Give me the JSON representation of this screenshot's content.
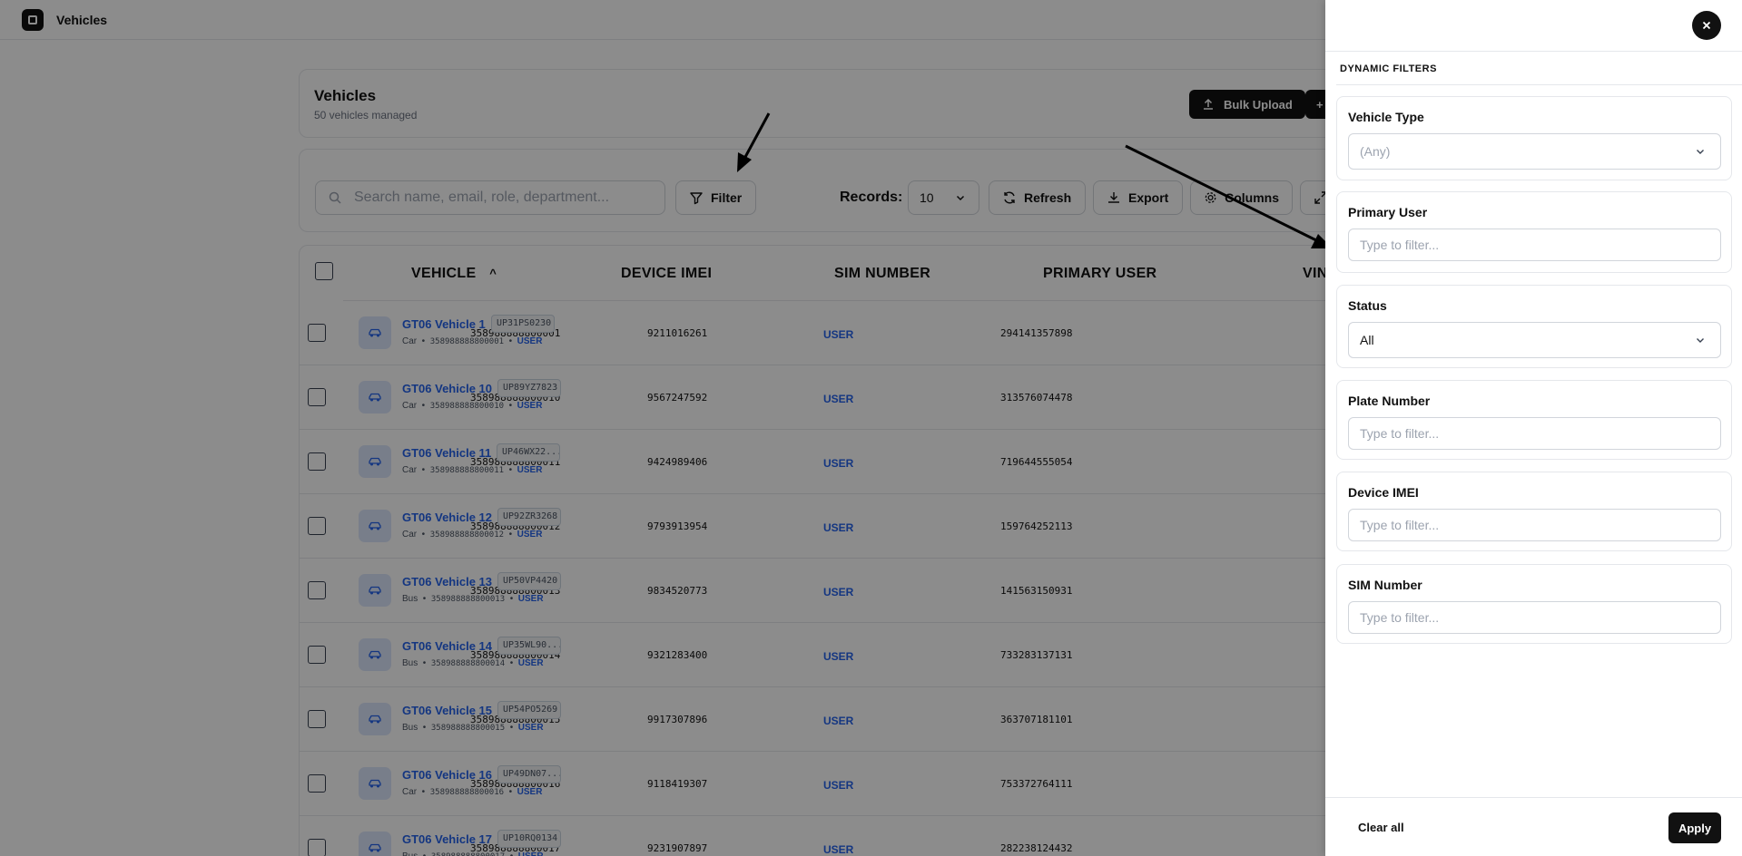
{
  "app": {
    "title": "Vehicles"
  },
  "header": {
    "title": "Vehicles",
    "subtitle": "50 vehicles managed",
    "bulk_upload_label": "Bulk Upload",
    "add_label": "+"
  },
  "toolbar": {
    "search_placeholder": "Search name, email, role, department...",
    "filter_label": "Filter",
    "records_label": "Records:",
    "records_value": "10",
    "refresh_label": "Refresh",
    "export_label": "Export",
    "columns_label": "Columns"
  },
  "table": {
    "columns": [
      "VEHICLE",
      "DEVICE IMEI",
      "SIM NUMBER",
      "PRIMARY USER",
      "VIN"
    ],
    "sort_indicator": "^",
    "rows": [
      {
        "name": "GT06 Vehicle 1",
        "plate": "UP31PS0230",
        "type": "Car",
        "imei_short": "358988888800001",
        "imei": "358988888800001",
        "user_tag": "USER",
        "sim": "9211016261",
        "primary_user": "USER",
        "vin": "294141357898"
      },
      {
        "name": "GT06 Vehicle 10",
        "plate": "UP89YZ7823",
        "type": "Car",
        "imei_short": "358988888800010",
        "imei": "358988888800010",
        "user_tag": "USER",
        "sim": "9567247592",
        "primary_user": "USER",
        "vin": "313576074478"
      },
      {
        "name": "GT06 Vehicle 11",
        "plate": "UP46WX22...",
        "type": "Car",
        "imei_short": "358988888800011",
        "imei": "358988888800011",
        "user_tag": "USER",
        "sim": "9424989406",
        "primary_user": "USER",
        "vin": "719644555054"
      },
      {
        "name": "GT06 Vehicle 12",
        "plate": "UP92ZR3268",
        "type": "Car",
        "imei_short": "358988888800012",
        "imei": "358988888800012",
        "user_tag": "USER",
        "sim": "9793913954",
        "primary_user": "USER",
        "vin": "159764252113"
      },
      {
        "name": "GT06 Vehicle 13",
        "plate": "UP50VP4420",
        "type": "Bus",
        "imei_short": "358988888800013",
        "imei": "358988888800013",
        "user_tag": "USER",
        "sim": "9834520773",
        "primary_user": "USER",
        "vin": "141563150931"
      },
      {
        "name": "GT06 Vehicle 14",
        "plate": "UP35WL90...",
        "type": "Bus",
        "imei_short": "358988888800014",
        "imei": "358988888800014",
        "user_tag": "USER",
        "sim": "9321283400",
        "primary_user": "USER",
        "vin": "733283137131"
      },
      {
        "name": "GT06 Vehicle 15",
        "plate": "UP54PO5269",
        "type": "Bus",
        "imei_short": "358988888800015",
        "imei": "358988888800015",
        "user_tag": "USER",
        "sim": "9917307896",
        "primary_user": "USER",
        "vin": "363707181101"
      },
      {
        "name": "GT06 Vehicle 16",
        "plate": "UP49DN07...",
        "type": "Car",
        "imei_short": "358988888800016",
        "imei": "358988888800016",
        "user_tag": "USER",
        "sim": "9118419307",
        "primary_user": "USER",
        "vin": "753372764111"
      },
      {
        "name": "GT06 Vehicle 17",
        "plate": "UP10RQ0134",
        "type": "Bus",
        "imei_short": "358988888800017",
        "imei": "358988888800017",
        "user_tag": "USER",
        "sim": "9231907897",
        "primary_user": "USER",
        "vin": "282238124432"
      }
    ]
  },
  "filters_panel": {
    "section_title": "DYNAMIC FILTERS",
    "fields": [
      {
        "label": "Vehicle Type",
        "kind": "select",
        "value": "(Any)",
        "muted": true
      },
      {
        "label": "Primary User",
        "kind": "input",
        "placeholder": "Type to filter..."
      },
      {
        "label": "Status",
        "kind": "select",
        "value": "All",
        "muted": false
      },
      {
        "label": "Plate Number",
        "kind": "input",
        "placeholder": "Type to filter..."
      },
      {
        "label": "Device IMEI",
        "kind": "input",
        "placeholder": "Type to filter..."
      },
      {
        "label": "SIM Number",
        "kind": "input",
        "placeholder": "Type to filter..."
      }
    ],
    "clear_label": "Clear all",
    "apply_label": "Apply"
  },
  "colors": {
    "accent": "#2563eb",
    "dark": "#111111",
    "overlay": "rgba(0,0,0,0.45)"
  },
  "icons": [
    "app-logo-icon",
    "upload-icon",
    "search-icon",
    "filter-icon",
    "chevron-down-icon",
    "refresh-icon",
    "download-icon",
    "gear-icon",
    "expand-icon",
    "car-icon",
    "close-icon",
    "arrow-annotation"
  ]
}
